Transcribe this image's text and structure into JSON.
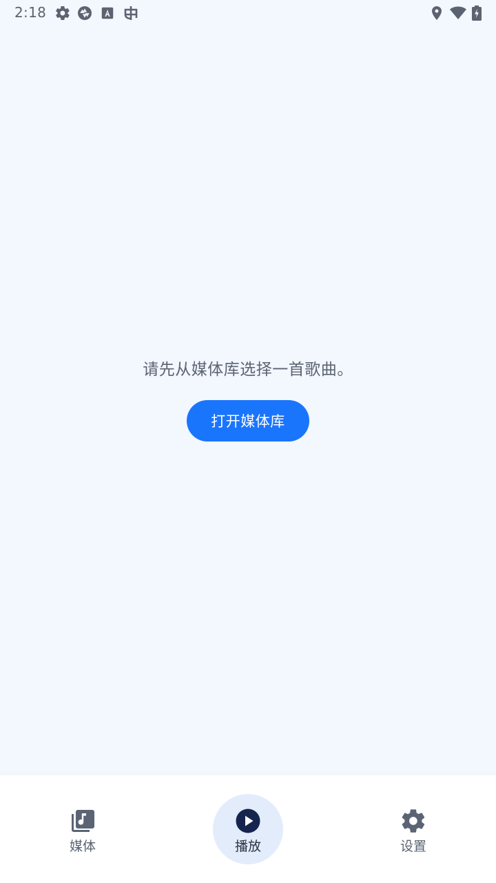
{
  "status_bar": {
    "time": "2:18",
    "left_icons": [
      "gear-icon",
      "aperture-icon",
      "font-a-icon",
      "bug-icon"
    ],
    "right_icons": [
      "location-icon",
      "wifi-icon",
      "battery-charging-icon"
    ]
  },
  "main": {
    "empty_message": "请先从媒体库选择一首歌曲。",
    "open_library_label": "打开媒体库"
  },
  "bottom_nav": {
    "items": [
      {
        "label": "媒体",
        "icon": "music-library-icon",
        "active": false
      },
      {
        "label": "播放",
        "icon": "play-circle-icon",
        "active": true
      },
      {
        "label": "设置",
        "icon": "settings-gear-icon",
        "active": false
      }
    ]
  },
  "colors": {
    "background": "#f3f7fe",
    "accent": "#1a75fd",
    "nav_active_bg": "#e3ecfb",
    "text_muted": "#5b6473",
    "icon_dark": "#16254d"
  }
}
